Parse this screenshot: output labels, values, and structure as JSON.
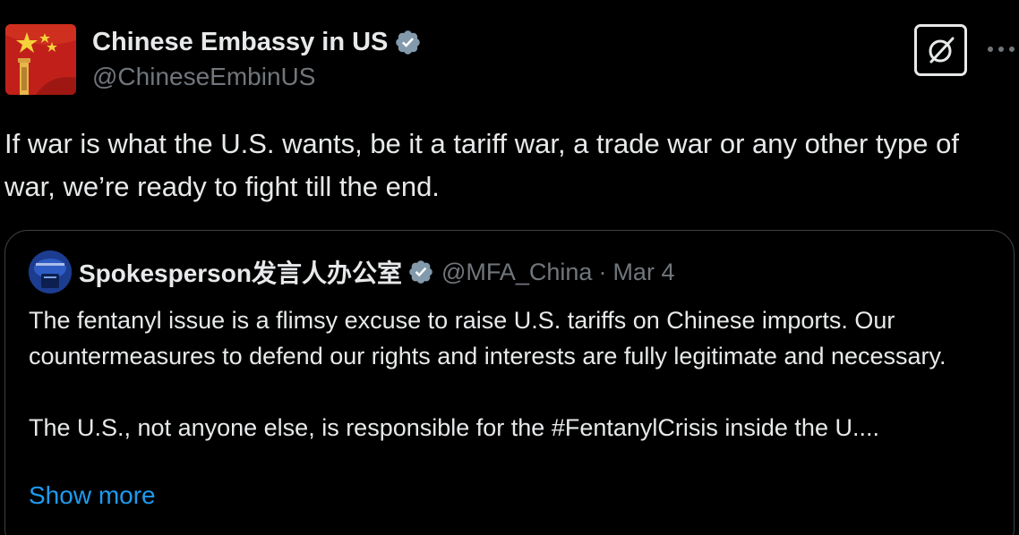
{
  "author": {
    "display_name": "Chinese Embassy in US",
    "handle": "@ChineseEmbinUS",
    "verified_icon": "verified-badge-icon",
    "avatar": "china-flag-avatar"
  },
  "actions": {
    "grok_icon": "grok-icon",
    "more_icon": "more-icon"
  },
  "tweet": {
    "text": "If war is what the U.S. wants, be it a tariff war, a trade war or any other type of war, we’re ready to fight till the end."
  },
  "quote": {
    "display_name": "Spokesperson发言人办公室",
    "handle": "@MFA_China",
    "separator": "·",
    "date": "Mar 4",
    "paragraphs": [
      "The fentanyl issue is a flimsy excuse to raise U.S. tariffs on Chinese imports. Our countermeasures to defend our rights and interests are fully legitimate and necessary.",
      "The U.S., not anyone else, is responsible for the #FentanylCrisis inside the U...."
    ],
    "show_more": "Show more"
  },
  "colors": {
    "background": "#000000",
    "primary_text": "#e7e9ea",
    "secondary_text": "#71767b",
    "link": "#1d9bf0",
    "border": "#3e4144",
    "verified": "#829aab"
  }
}
